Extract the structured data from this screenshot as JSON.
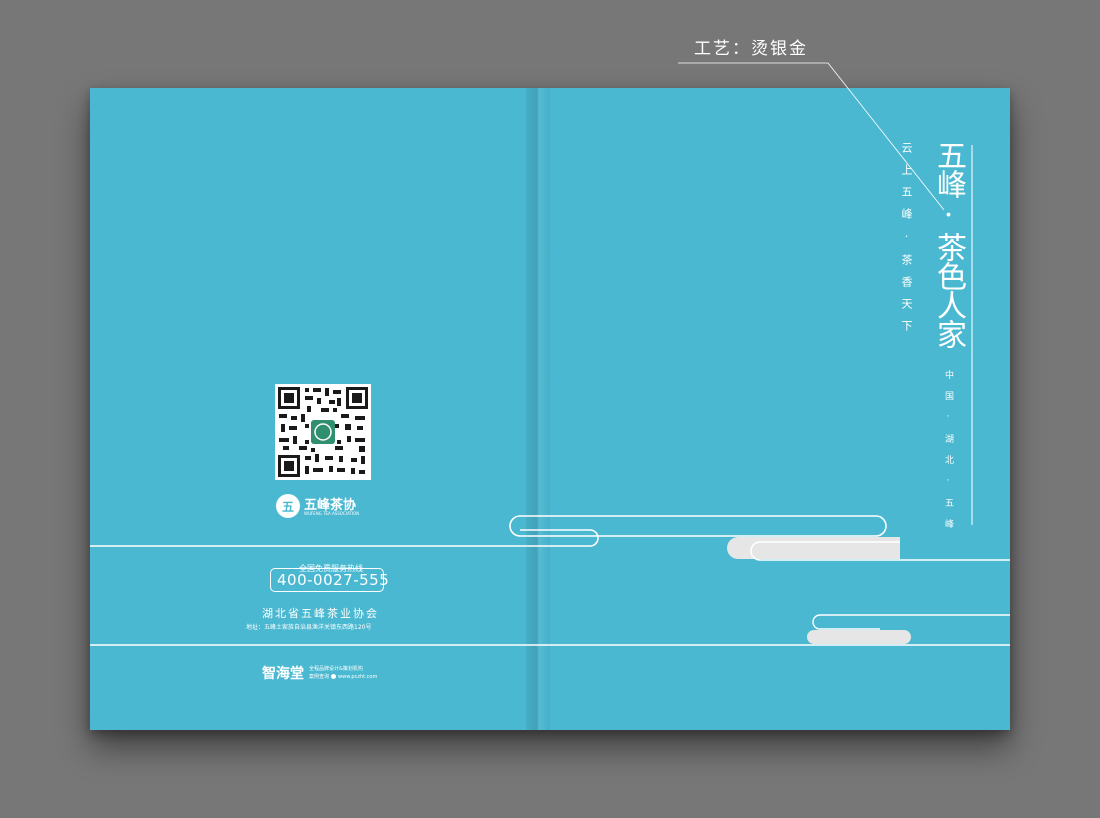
{
  "callout": {
    "text": "工艺：烫银金"
  },
  "front_cover": {
    "title": "五峰·茶色人家",
    "location": "中国·湖北·五峰"
  },
  "back_cover": {
    "slogan": "云上五峰·茶香天下",
    "logo": {
      "mark": "五",
      "name_cn": "五峰茶协",
      "name_en": "WUFENG TEA ASSOCIATION"
    },
    "hotline": {
      "label": "全国免费服务热线",
      "number": "400-0027-555"
    },
    "association_name": "湖北省五峰茶业协会",
    "address": "地址：五峰土家族自治县渔洋关镇东西路120号",
    "agency": {
      "name": "智海堂",
      "description": "全程品牌设计&策划机构",
      "site_prefix": "案例查询",
      "site": "www.pczht.com"
    },
    "qr_icon": "qr-code-icon"
  },
  "colors": {
    "cover": "#4ab8d1",
    "background": "#777777",
    "line": "#ffffff",
    "cloud_fill": "#e6e6e6"
  }
}
